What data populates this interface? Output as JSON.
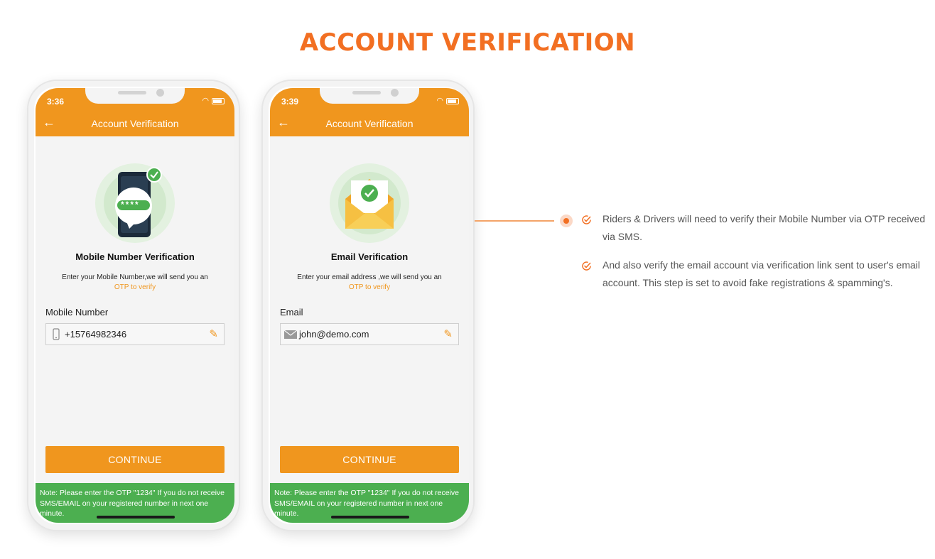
{
  "page": {
    "title": "ACCOUNT VERIFICATION"
  },
  "phones": [
    {
      "status_time": "3:36",
      "header_title": "Account Verification",
      "verification_title": "Mobile Number  Verification",
      "description": "Enter your Mobile Number,we will send you an",
      "otp_text": "OTP to verify",
      "field_label": "Mobile Number",
      "field_value": "+15764982346",
      "otp_mask": "****",
      "continue_label": "CONTINUE",
      "note": "Note: Please enter the OTP \"1234\" If you do not receive SMS/EMAIL on your registered number in next one minute."
    },
    {
      "status_time": "3:39",
      "header_title": "Account Verification",
      "verification_title": "Email Verification",
      "description": "Enter your email address ,we will send you an",
      "otp_text": "OTP to verify",
      "field_label": "Email",
      "field_value": "john@demo.com",
      "continue_label": "CONTINUE",
      "note": "Note: Please enter the OTP \"1234\" If you do not receive SMS/EMAIL on your registered number in next one minute."
    }
  ],
  "features": [
    {
      "text": "Riders & Drivers will need to verify their Mobile Number via OTP received via SMS."
    },
    {
      "text": "And also verify the email account via verification link sent to user's email account. This step is set to avoid fake registrations & spamming's."
    }
  ],
  "colors": {
    "accent": "#f26f22",
    "header": "#f0961e",
    "note_bg": "#4caf50",
    "success": "#4caf50"
  },
  "icons": [
    "back-arrow-icon",
    "phone-otp-icon",
    "email-envelope-icon",
    "mobile-icon",
    "mail-icon",
    "edit-pencil-icon",
    "check-circle-icon",
    "wifi-icon",
    "battery-icon"
  ]
}
